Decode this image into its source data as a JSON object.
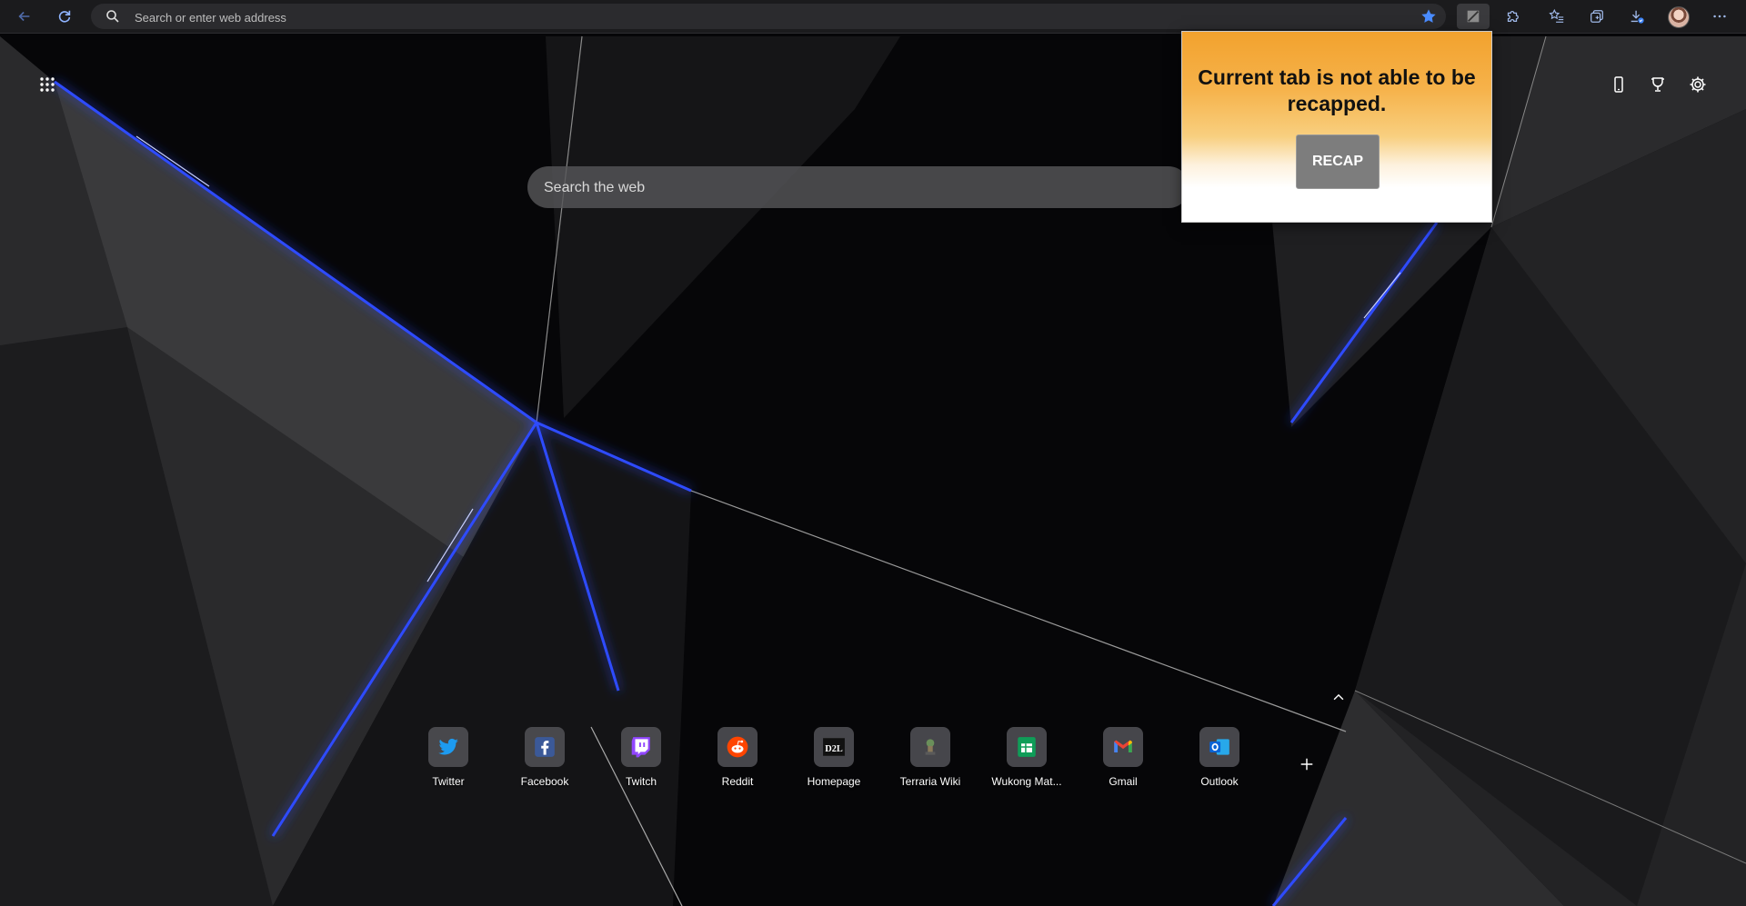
{
  "browser": {
    "address_placeholder": "Search or enter web address"
  },
  "search": {
    "placeholder": "Search the web"
  },
  "popup": {
    "message": "Current tab is not able to be recapped.",
    "button": "RECAP"
  },
  "quick_links": [
    {
      "label": "Twitter",
      "icon": "twitter-icon",
      "color": "#1d9bf0"
    },
    {
      "label": "Facebook",
      "icon": "facebook-icon",
      "color": "#3b5998"
    },
    {
      "label": "Twitch",
      "icon": "twitch-icon",
      "color": "#9146ff"
    },
    {
      "label": "Reddit",
      "icon": "reddit-icon",
      "color": "#ff4500"
    },
    {
      "label": "Homepage",
      "icon": "d2l-icon",
      "color": "#111111"
    },
    {
      "label": "Terraria Wiki",
      "icon": "terraria-icon",
      "color": "#6a8f5a"
    },
    {
      "label": "Wukong Mat...",
      "icon": "sheets-icon",
      "color": "#0f9d58"
    },
    {
      "label": "Gmail",
      "icon": "gmail-icon",
      "color": "#ea4335"
    },
    {
      "label": "Outlook",
      "icon": "outlook-icon",
      "color": "#0a64d6"
    }
  ],
  "d2l_text": "D2L",
  "colors": {
    "accent_blue": "#2f6bff",
    "toolbar_bg": "#1b1b1d"
  }
}
